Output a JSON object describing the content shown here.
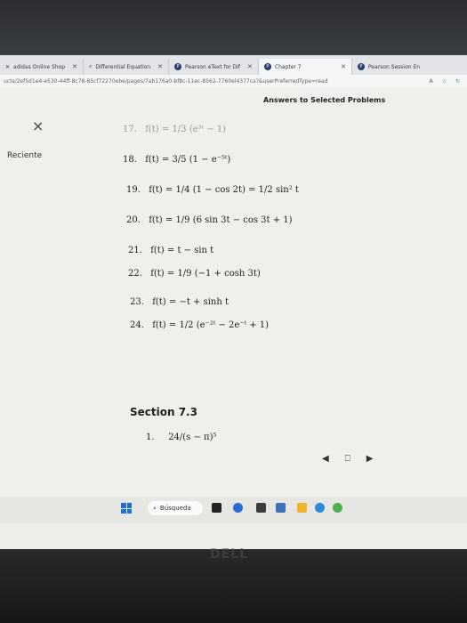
{
  "browser": {
    "tabs": [
      {
        "label": "adidas Online Shop"
      },
      {
        "label": "Differential Equation"
      },
      {
        "label": "Pearson eText for Dif"
      },
      {
        "label": "Chapter 7"
      },
      {
        "label": "Pearson Session En"
      }
    ],
    "url": "ucts/2ef5d1e4-e530-44ff-8c78-85cf72270ebe/pages/7ab176a0-bf8c-11ec-8562-7760el4377ca?&userPreferredType=read"
  },
  "page": {
    "close_symbol": "×",
    "sidebar_label": "Reciente",
    "answers_title": "Answers to Selected Problems",
    "items": [
      {
        "num": "17.",
        "expr": "f(t) = 1/3 (e³ᵗ − 1)"
      },
      {
        "num": "18.",
        "expr": "f(t) = 3/5 (1 − e⁻⁵ᵗ)"
      },
      {
        "num": "19.",
        "expr": "f(t) = 1/4 (1 − cos 2t) = 1/2 sin² t"
      },
      {
        "num": "20.",
        "expr": "f(t) = 1/9 (6 sin 3t − cos 3t + 1)"
      },
      {
        "num": "21.",
        "expr": "f(t) = t − sin t"
      },
      {
        "num": "22.",
        "expr": "f(t) = 1/9 (−1 + cosh 3t)"
      },
      {
        "num": "23.",
        "expr": "f(t) = −t + sinh t"
      },
      {
        "num": "24.",
        "expr": "f(t) = 1/2 (e⁻²ᵗ − 2e⁻ᵗ + 1)"
      }
    ],
    "section_title": "Section 7.3",
    "section_items": [
      {
        "num": "1.",
        "expr": "24/(s − π)⁵"
      }
    ]
  },
  "taskbar": {
    "search_label": "Búsqueda"
  },
  "bezel": {
    "logo": "DELL"
  }
}
